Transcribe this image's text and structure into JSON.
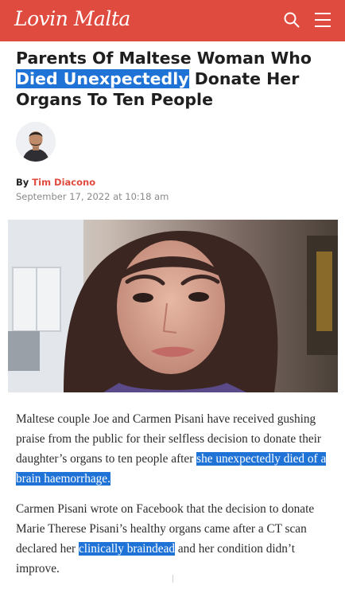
{
  "header": {
    "logo_text": "Lovin Malta",
    "brand_color": "#e04b3f",
    "search_icon": "search-icon",
    "menu_icon": "hamburger-menu-icon"
  },
  "article": {
    "title_before": "Parents Of Maltese Woman Who ",
    "title_highlight": "Died Unexpectedly",
    "title_after": " Donate Her Organs To Ten People",
    "by_label": "By",
    "author": "Tim Diacono",
    "date": "September 17, 2022 at 10:18 am",
    "paragraph1_text": "Maltese couple Joe and Carmen Pisani have received gushing praise from the public for their selfless decision to donate their daughter’s organs to ten people after ",
    "paragraph1_link": "she unexpectedly died of a brain haemorrhage.",
    "paragraph2_text": "Carmen Pisani wrote on Facebook that the decision to donate Marie Therese Pisani’s healthy organs came after a CT scan declared her ",
    "paragraph2_link": "clinically braindead",
    "paragraph2_after": " and her condition didn’t improve."
  },
  "highlight_color": "#1f72d6"
}
